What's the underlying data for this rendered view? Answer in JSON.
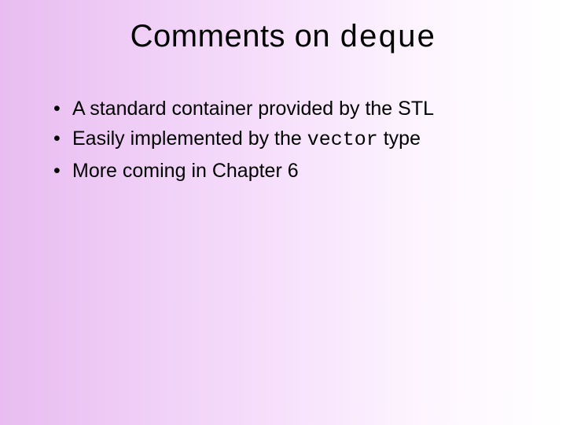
{
  "title": {
    "prefix": "Comments on ",
    "code": "deque"
  },
  "bullets": [
    {
      "text": "A standard container provided by the STL"
    },
    {
      "pre": "Easily implemented by the ",
      "code": "vector",
      "post": " type"
    },
    {
      "text": "More coming in Chapter 6"
    }
  ]
}
